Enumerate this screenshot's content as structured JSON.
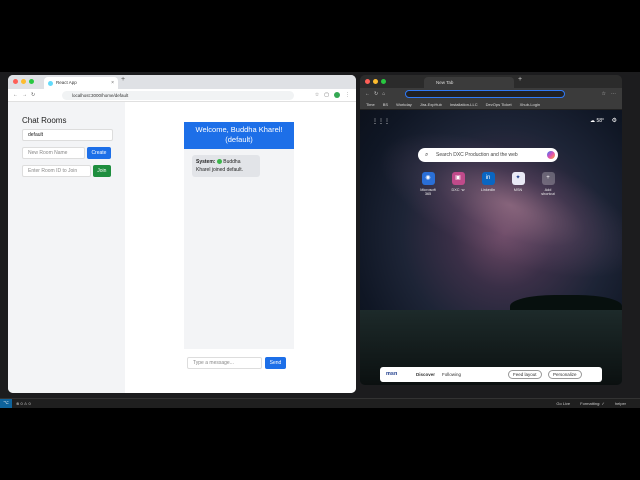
{
  "left_browser": {
    "tab_title": "React App",
    "url": "localhost:3000/home/default",
    "sidebar": {
      "title": "Chat Rooms",
      "current_room": "default",
      "new_room_placeholder": "New Room Name",
      "create_label": "Create",
      "room_id_placeholder": "Enter Room ID to Join",
      "join_label": "Join"
    },
    "chat": {
      "header": "Welcome, Buddha Kharel! (default)",
      "messages": [
        {
          "sender": "System:",
          "text": "Buddha Kharel joined default."
        }
      ],
      "input_placeholder": "Type a message...",
      "send_label": "Send"
    }
  },
  "right_browser": {
    "tab_title": "New Tab",
    "bookmarks": [
      "Time",
      "BS",
      "Workday",
      "Jira-ExpHub",
      "Installation-LLC",
      "DevOps Ticket",
      "Xhub-Login"
    ],
    "weather": "58°",
    "search_placeholder": "Search DXC Production and the web",
    "shortcuts": [
      {
        "label": "Microsoft 365",
        "icon": "office-icon"
      },
      {
        "label": "DXC ·w",
        "icon": "dxc-icon"
      },
      {
        "label": "LinkedIn",
        "icon": "linkedin-icon"
      },
      {
        "label": "MSN",
        "icon": "msn-icon"
      },
      {
        "label": "Add shortcut",
        "icon": "plus-icon"
      }
    ],
    "msn_bar": {
      "logo": "msn",
      "discover": "Discover",
      "following": "Following",
      "feed_layout": "Feed layout",
      "personalize": "Personalize"
    }
  },
  "status_bar": {
    "problems": "⊗ 0 ⚠ 0",
    "items": [
      "Go Live",
      "Formatting: ✓",
      "helper"
    ]
  }
}
